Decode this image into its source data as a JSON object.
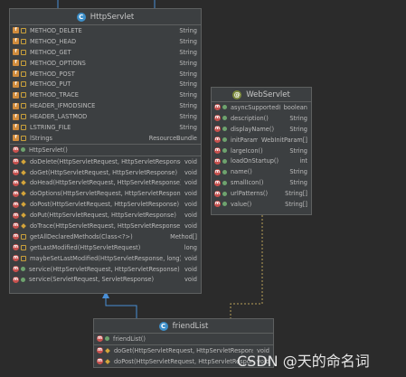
{
  "http_servlet": {
    "title": "HttpServlet",
    "fields": [
      {
        "name": "METHOD_DELETE",
        "type": "String"
      },
      {
        "name": "METHOD_HEAD",
        "type": "String"
      },
      {
        "name": "METHOD_GET",
        "type": "String"
      },
      {
        "name": "METHOD_OPTIONS",
        "type": "String"
      },
      {
        "name": "METHOD_POST",
        "type": "String"
      },
      {
        "name": "METHOD_PUT",
        "type": "String"
      },
      {
        "name": "METHOD_TRACE",
        "type": "String"
      },
      {
        "name": "HEADER_IFMODSINCE",
        "type": "String"
      },
      {
        "name": "HEADER_LASTMOD",
        "type": "String"
      },
      {
        "name": "LSTRING_FILE",
        "type": "String"
      },
      {
        "name": "lStrings",
        "type": "ResourceBundle"
      }
    ],
    "constructors": [
      {
        "name": "HttpServlet()",
        "type": ""
      }
    ],
    "methods": [
      {
        "name": "doDelete(HttpServletRequest, HttpServletResponse)",
        "type": "void"
      },
      {
        "name": "doGet(HttpServletRequest, HttpServletResponse)",
        "type": "void"
      },
      {
        "name": "doHead(HttpServletRequest, HttpServletResponse)",
        "type": "void"
      },
      {
        "name": "doOptions(HttpServletRequest, HttpServletResponse)",
        "type": "void"
      },
      {
        "name": "doPost(HttpServletRequest, HttpServletResponse)",
        "type": "void"
      },
      {
        "name": "doPut(HttpServletRequest, HttpServletResponse)",
        "type": "void"
      },
      {
        "name": "doTrace(HttpServletRequest, HttpServletResponse)",
        "type": "void"
      },
      {
        "name": "getAllDeclaredMethods(Class<?>)",
        "type": "Method[]"
      },
      {
        "name": "getLastModified(HttpServletRequest)",
        "type": "long"
      },
      {
        "name": "maybeSetLastModified(HttpServletResponse, long)",
        "type": "void"
      },
      {
        "name": "service(HttpServletRequest, HttpServletResponse)",
        "type": "void"
      },
      {
        "name": "service(ServletRequest, ServletResponse)",
        "type": "void"
      }
    ]
  },
  "web_servlet": {
    "title": "WebServlet",
    "methods": [
      {
        "name": "asyncSupported()",
        "type": "boolean"
      },
      {
        "name": "description()",
        "type": "String"
      },
      {
        "name": "displayName()",
        "type": "String"
      },
      {
        "name": "initParams()",
        "type": "WebInitParam[]"
      },
      {
        "name": "largeIcon()",
        "type": "String"
      },
      {
        "name": "loadOnStartup()",
        "type": "int"
      },
      {
        "name": "name()",
        "type": "String"
      },
      {
        "name": "smallIcon()",
        "type": "String"
      },
      {
        "name": "urlPatterns()",
        "type": "String[]"
      },
      {
        "name": "value()",
        "type": "String[]"
      }
    ]
  },
  "friend_list": {
    "title": "friendList",
    "constructors": [
      {
        "name": "friendList()",
        "type": ""
      }
    ],
    "methods": [
      {
        "name": "doGet(HttpServletRequest, HttpServletResponse)",
        "type": "void"
      },
      {
        "name": "doPost(HttpServletRequest, HttpServletResponse)",
        "type": "void"
      }
    ]
  },
  "watermark": "CSDN @天的命名词",
  "colors": {
    "background": "#2b2b2b",
    "box": "#3c3f41",
    "border": "#5e6060",
    "inherit_arrow": "#4a8fd6",
    "annotation_link": "#b8a15a",
    "class_icon": "#3d8fc9",
    "field_icon": "#d08b3c",
    "method_icon": "#c8514e"
  }
}
